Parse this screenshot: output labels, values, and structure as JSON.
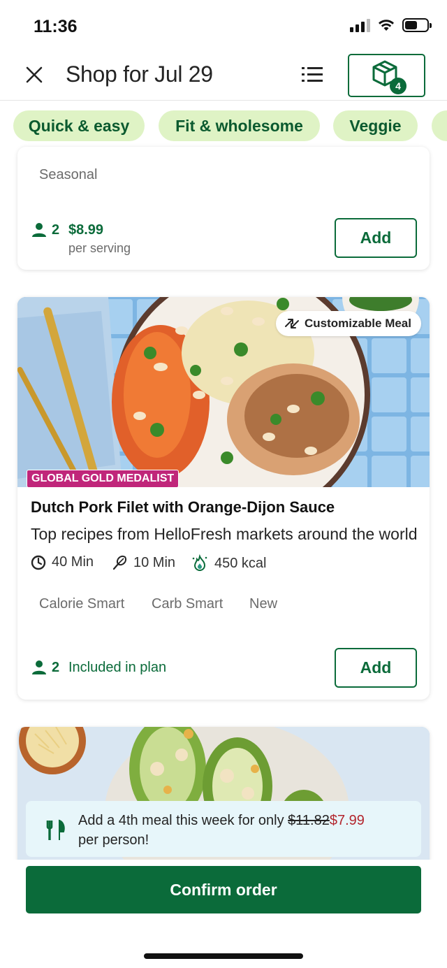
{
  "status_bar": {
    "time": "11:36"
  },
  "header": {
    "title": "Shop for Jul 29",
    "box_count": "4"
  },
  "filters": [
    {
      "label": "Quick & easy"
    },
    {
      "label": "Fit & wholesome"
    },
    {
      "label": "Veggie"
    },
    {
      "label": ""
    }
  ],
  "card_top": {
    "tag": "Seasonal",
    "servings": "2",
    "price": "$8.99",
    "price_unit": "per serving",
    "add_label": "Add"
  },
  "card_main": {
    "badge_custom": "Customizable Meal",
    "badge_award": "GLOBAL GOLD MEDALIST",
    "title": "Dutch Pork Filet with Orange-Dijon Sauce",
    "subtitle": "Top recipes from HelloFresh markets around the world",
    "total_time": "40 Min",
    "prep_time": "10 Min",
    "calories": "450 kcal",
    "tags": [
      "Calorie Smart",
      "Carb Smart",
      "New"
    ],
    "servings": "2",
    "included_text": "Included in plan",
    "add_label": "Add"
  },
  "upsell": {
    "text_before": "Add a 4th meal this week for only",
    "old_price": "$11.82",
    "new_price": "$7.99",
    "text_after": "per person!"
  },
  "confirm": {
    "label": "Confirm order"
  },
  "colors": {
    "brand_green": "#0b6b3a",
    "chip_bg": "#dff3c5",
    "award_magenta": "#c0267a",
    "price_red": "#b3262e"
  },
  "icons": [
    "close-icon",
    "list-icon",
    "box-icon",
    "person-icon",
    "clock-icon",
    "whisk-icon",
    "flame-icon",
    "swap-icon",
    "cutlery-icon"
  ]
}
